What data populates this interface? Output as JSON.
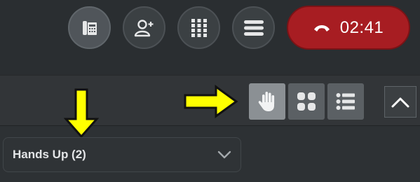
{
  "call_controls": {
    "buttons": [
      {
        "name": "dialpad-phone",
        "icon": "desk-phone-icon"
      },
      {
        "name": "add-participant",
        "icon": "add-person-icon"
      },
      {
        "name": "keypad",
        "icon": "keypad-grid-icon"
      },
      {
        "name": "menu",
        "icon": "hamburger-menu-icon"
      }
    ],
    "hangup": {
      "icon": "hang-up-icon",
      "color": "#a71d22"
    },
    "timer": "02:41"
  },
  "view_controls": {
    "buttons": [
      {
        "name": "hands-up-view",
        "icon": "raised-hand-icon",
        "selected": true
      },
      {
        "name": "grid-view",
        "icon": "grid-icon",
        "selected": false
      },
      {
        "name": "list-view",
        "icon": "list-icon",
        "selected": false
      }
    ],
    "collapse_icon": "chevron-up-icon"
  },
  "panel": {
    "dropdown_label": "Hands Up (2)",
    "dropdown_icon": "chevron-down-icon"
  },
  "annotations": {
    "arrow_color": "#ffff00",
    "arrows": [
      "down-arrow",
      "right-arrow"
    ]
  }
}
